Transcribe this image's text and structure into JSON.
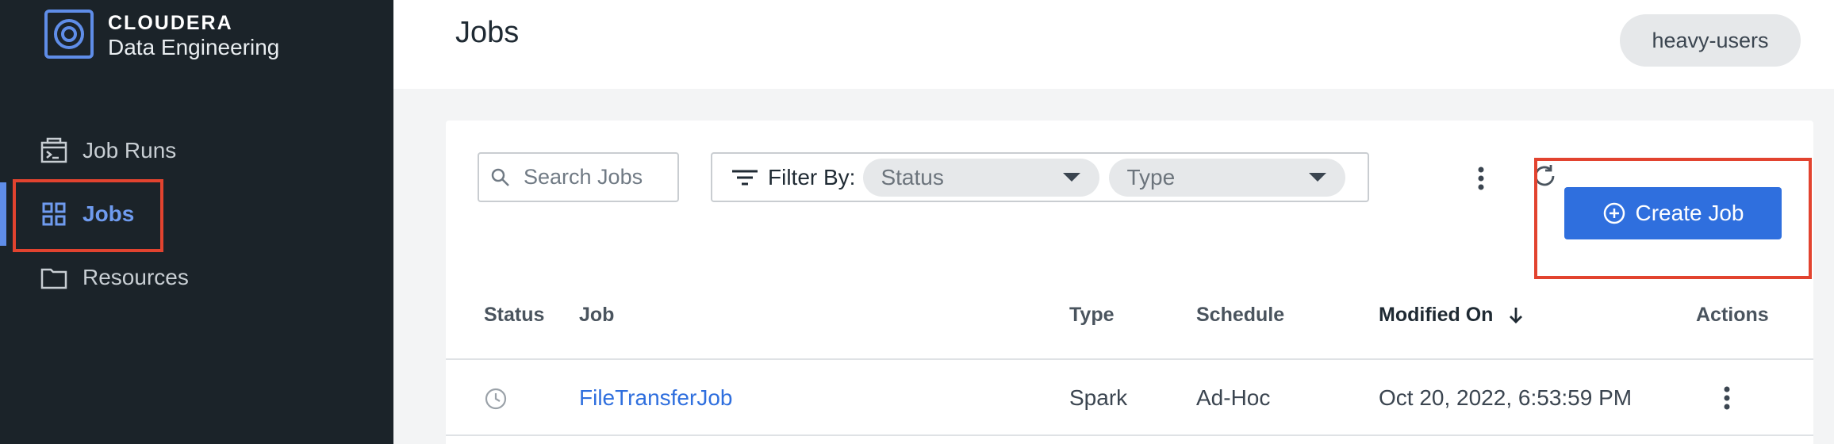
{
  "brand": {
    "name": "CLOUDERA",
    "product": "Data Engineering"
  },
  "sidebar": {
    "items": [
      {
        "label": "Job Runs",
        "icon": "terminal-icon",
        "active": false
      },
      {
        "label": "Jobs",
        "icon": "grid-icon",
        "active": true
      },
      {
        "label": "Resources",
        "icon": "folder-icon",
        "active": false
      }
    ]
  },
  "header": {
    "title": "Jobs",
    "user_chip": "heavy-users"
  },
  "toolbar": {
    "search_placeholder": "Search Jobs",
    "filter_label": "Filter By:",
    "status_placeholder": "Status",
    "type_placeholder": "Type",
    "create_label": "Create Job"
  },
  "table": {
    "columns": [
      "Status",
      "Job",
      "Type",
      "Schedule",
      "Modified On",
      "Actions"
    ],
    "sorted_column": "Modified On",
    "sort_direction": "descending",
    "rows": [
      {
        "status_icon": "clock-icon",
        "job": "FileTransferJob",
        "type": "Spark",
        "schedule": "Ad-Hoc",
        "modified_on": "Oct 20, 2022, 6:53:59 PM"
      }
    ]
  },
  "colors": {
    "accent": "#2f6fde",
    "sidebar_bg": "#1b2329",
    "active_nav": "#6f9bef",
    "highlight": "#e2432f"
  }
}
